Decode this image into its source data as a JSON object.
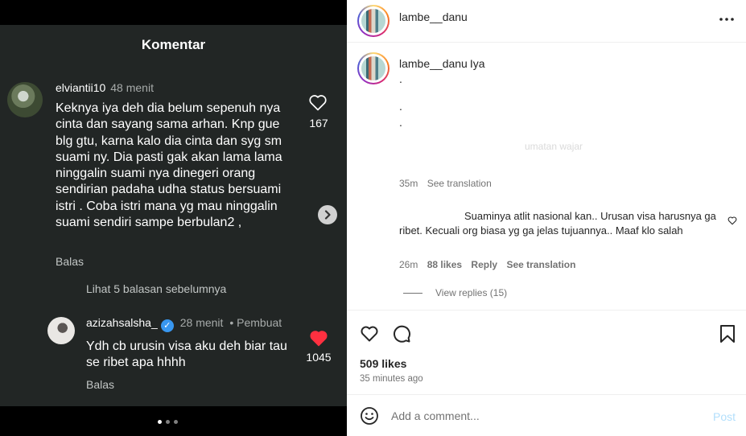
{
  "media": {
    "sheet_title": "Komentar",
    "comment1": {
      "username": "elviantii10",
      "time": "48 menit",
      "text": "Keknya iya deh dia belum sepenuh nya cinta dan sayang sama arhan. Knp gue blg gtu, karna kalo dia cinta dan syg sm suami ny. Dia pasti gak akan lama lama ninggalin suami nya dinegeri orang sendirian padaha udha status bersuami istri . Coba istri mana yg mau ninggalin suami sendiri sampe berbulan2 ,",
      "reply_label": "Balas",
      "likes": "167"
    },
    "more_replies": "Lihat 5 balasan sebelumnya",
    "comment2": {
      "username": "azizahsalsha_",
      "time": "28 menit",
      "creator_tag": "• Pembuat",
      "text": "Ydh cb urusin visa aku deh biar tau se ribet apa hhhh",
      "reply_label": "Balas",
      "likes": "1045"
    },
    "carousel": {
      "count": 3,
      "active": 0
    }
  },
  "panel": {
    "username": "lambe__danu",
    "caption": {
      "username": "lambe__danu",
      "text": "Iya",
      "dot_lines": [
        ".",
        ".",
        "."
      ],
      "faint_text": "umatan wajar",
      "time": "35m",
      "see_translation": "See translation"
    },
    "comment": {
      "text": "Suaminya atlit nasional kan.. Urusan visa harusnya ga ribet. Kecuali org biasa yg ga jelas tujuannya.. Maaf klo salah",
      "time": "26m",
      "likes": "88 likes",
      "reply": "Reply",
      "see_translation": "See translation",
      "view_replies": "View replies (15)"
    },
    "likes": "509 likes",
    "posted_ago": "35 minutes ago",
    "add_comment_placeholder": "Add a comment...",
    "post_label": "Post"
  },
  "colors": {
    "liked": "#ff3040",
    "verified": "#3897f0",
    "post_disabled": "#b2dffc"
  }
}
